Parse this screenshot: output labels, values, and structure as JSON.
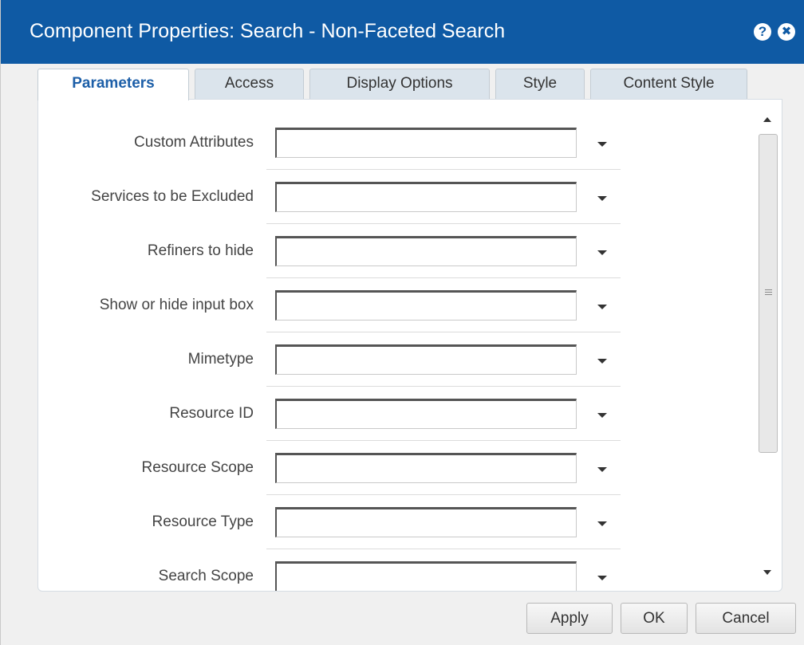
{
  "window": {
    "title": "Component Properties: Search - Non-Faceted Search",
    "help_glyph": "?",
    "close_glyph": "✖"
  },
  "tabs": [
    {
      "label": "Parameters",
      "active": true
    },
    {
      "label": "Access",
      "active": false
    },
    {
      "label": "Display Options",
      "active": false
    },
    {
      "label": "Style",
      "active": false
    },
    {
      "label": "Content Style",
      "active": false
    }
  ],
  "parameters": [
    {
      "label": "Custom Attributes",
      "value": ""
    },
    {
      "label": "Services to be Excluded",
      "value": ""
    },
    {
      "label": "Refiners to hide",
      "value": ""
    },
    {
      "label": "Show or hide input box",
      "value": ""
    },
    {
      "label": "Mimetype",
      "value": ""
    },
    {
      "label": "Resource ID",
      "value": ""
    },
    {
      "label": "Resource Scope",
      "value": ""
    },
    {
      "label": "Resource Type",
      "value": ""
    },
    {
      "label": "Search Scope",
      "value": ""
    }
  ],
  "footer": {
    "apply_label": "Apply",
    "ok_label": "OK",
    "cancel_label": "Cancel"
  },
  "colors": {
    "titlebar": "#0f5aa4",
    "active_tab_text": "#1d5fa8",
    "tab_bg": "#dbe4ec"
  },
  "icons": {
    "help": "help-icon",
    "close": "close-icon",
    "dropdown": "chevron-down-icon"
  }
}
